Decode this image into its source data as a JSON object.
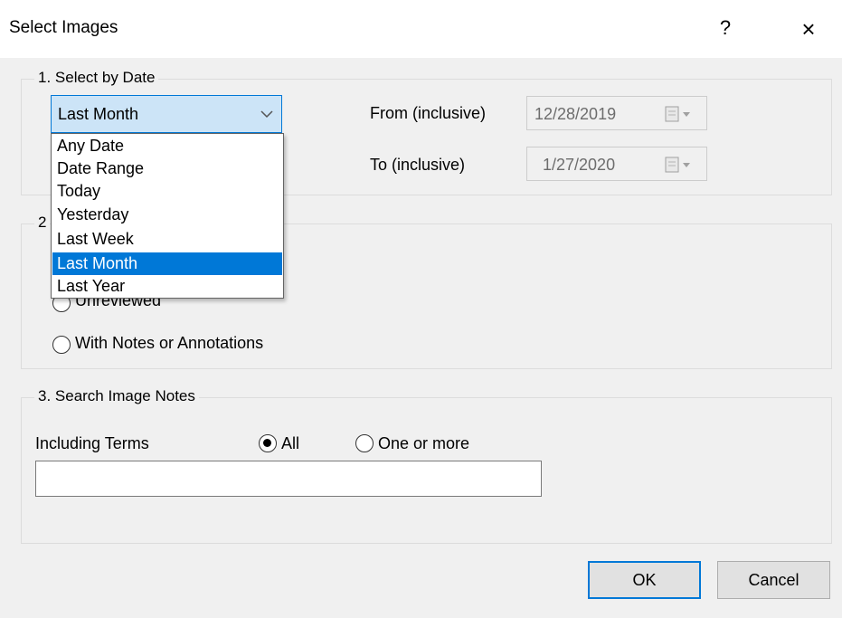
{
  "window": {
    "title": "Select Images",
    "help_label": "?",
    "close_label": "×"
  },
  "section1": {
    "legend": "1. Select by Date",
    "combo_value": "Last Month",
    "dropdown_items": [
      "Any Date",
      "Date Range",
      "Today",
      "Yesterday",
      "Last Week",
      "Last Month",
      "Last Year"
    ],
    "selected_item": "Last Month",
    "from_label": "From (inclusive)",
    "from_value": "12/28/2019",
    "to_label": "To (inclusive)",
    "to_value": "1/27/2020"
  },
  "section2": {
    "legend_fragment": "2",
    "unreviewed_label": "Unreviewed",
    "notes_label": "With Notes or Annotations"
  },
  "section3": {
    "legend": "3. Search Image Notes",
    "terms_label": "Including Terms",
    "option_all": "All",
    "option_one_or_more": "One or more",
    "terms_value": ""
  },
  "buttons": {
    "ok": "OK",
    "cancel": "Cancel"
  },
  "colors": {
    "accent": "#0078d7",
    "combo_bg": "#cce4f7",
    "dialog_bg": "#f0f0f0"
  }
}
